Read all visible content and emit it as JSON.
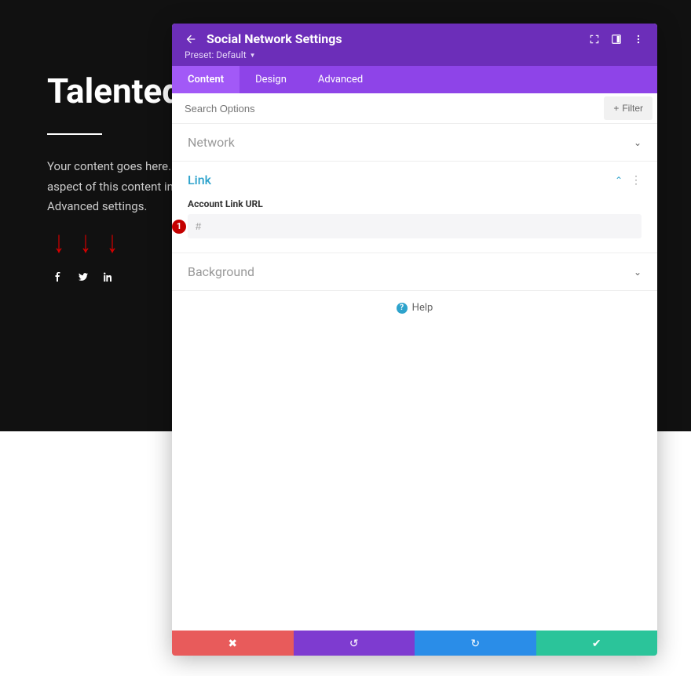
{
  "page": {
    "heading": "Talented",
    "body_text": "Your content goes here. Edit or remove this text inline or in the module Content settings. You can also style every aspect of this content in the module Design settings and even apply custom CSS to this text in the module Advanced settings."
  },
  "social": {
    "items": [
      "facebook",
      "twitter",
      "linkedin"
    ]
  },
  "modal": {
    "title": "Social Network Settings",
    "preset_label": "Preset: Default",
    "tabs": {
      "content": "Content",
      "design": "Design",
      "advanced": "Advanced"
    },
    "search_placeholder": "Search Options",
    "filter_label": "Filter",
    "sections": {
      "network": {
        "label": "Network"
      },
      "link": {
        "label": "Link",
        "field_label": "Account Link URL",
        "value": "#"
      },
      "background": {
        "label": "Background"
      }
    },
    "help_label": "Help",
    "step_badge": "1"
  }
}
